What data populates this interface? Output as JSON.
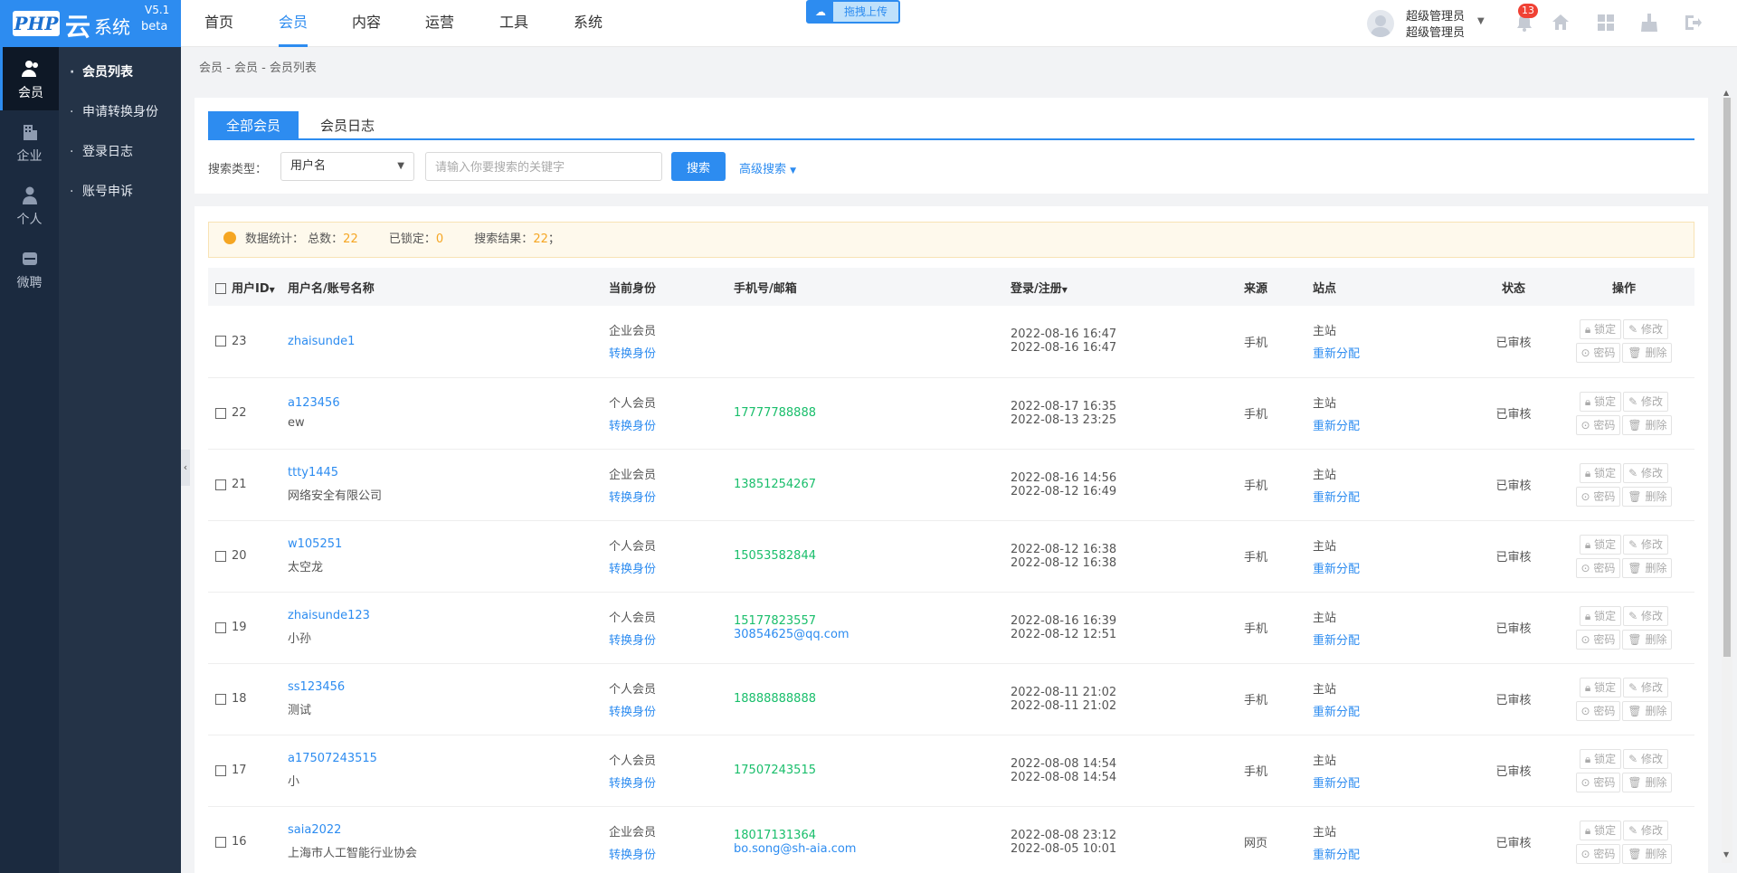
{
  "logo": {
    "brand": "PHP",
    "yun": "云",
    "system": "系统",
    "version": "V5.1",
    "beta": "beta"
  },
  "left_nav": [
    {
      "label": "会员",
      "icon": "members-icon",
      "active": true
    },
    {
      "label": "企业",
      "icon": "building-icon"
    },
    {
      "label": "个人",
      "icon": "person-icon"
    },
    {
      "label": "微聘",
      "icon": "micro-recruit-icon"
    }
  ],
  "sub_nav": [
    {
      "label": "会员列表",
      "active": true
    },
    {
      "label": "申请转换身份"
    },
    {
      "label": "登录日志"
    },
    {
      "label": "账号申诉"
    }
  ],
  "top_menu": [
    {
      "label": "首页"
    },
    {
      "label": "会员",
      "active": true
    },
    {
      "label": "内容"
    },
    {
      "label": "运营"
    },
    {
      "label": "工具"
    },
    {
      "label": "系统"
    }
  ],
  "upload": {
    "label": "拖拽上传"
  },
  "user": {
    "line1": "超级管理员",
    "line2": "超级管理员",
    "notifications": "13"
  },
  "breadcrumb": "会员 - 会员 - 会员列表",
  "tabs": [
    {
      "label": "全部会员",
      "active": true
    },
    {
      "label": "会员日志"
    }
  ],
  "search": {
    "type_label": "搜索类型：",
    "type_value": "用户名",
    "placeholder": "请输入你要搜索的关键字",
    "button": "搜索",
    "advanced": "高级搜索"
  },
  "stats": {
    "label": "数据统计：",
    "total_label": "总数：",
    "total": "22",
    "locked_label": "已锁定：",
    "locked": "0",
    "result_label": "搜索结果：",
    "result": "22",
    "end": "；"
  },
  "columns": {
    "id": "用户ID",
    "name": "用户名/账号名称",
    "identity": "当前身份",
    "contact": "手机号/邮箱",
    "time": "登录/注册",
    "source": "来源",
    "site": "站点",
    "status": "状态",
    "ops": "操作"
  },
  "row_actions": {
    "switch": "转换身份",
    "reassign": "重新分配",
    "lock": "锁定",
    "edit": "修改",
    "password": "密码",
    "delete": "删除"
  },
  "rows": [
    {
      "id": "23",
      "user": "zhaisunde1",
      "account": "",
      "identity": "企业会员",
      "phone": "",
      "email": "",
      "login": "2022-08-16 16:47",
      "reg": "2022-08-16 16:47",
      "source": "手机",
      "site": "主站",
      "status": "已审核"
    },
    {
      "id": "22",
      "user": "a123456",
      "account": "ew",
      "identity": "个人会员",
      "phone": "17777788888",
      "email": "",
      "login": "2022-08-17 16:35",
      "reg": "2022-08-13 23:25",
      "source": "手机",
      "site": "主站",
      "status": "已审核"
    },
    {
      "id": "21",
      "user": "ttty1445",
      "account": "网络安全有限公司",
      "identity": "企业会员",
      "phone": "13851254267",
      "email": "",
      "login": "2022-08-16 14:56",
      "reg": "2022-08-12 16:49",
      "source": "手机",
      "site": "主站",
      "status": "已审核"
    },
    {
      "id": "20",
      "user": "w105251",
      "account": "太空龙",
      "identity": "个人会员",
      "phone": "15053582844",
      "email": "",
      "login": "2022-08-12 16:38",
      "reg": "2022-08-12 16:38",
      "source": "手机",
      "site": "主站",
      "status": "已审核"
    },
    {
      "id": "19",
      "user": "zhaisunde123",
      "account": "小孙",
      "identity": "个人会员",
      "phone": "15177823557",
      "email": "30854625@qq.com",
      "login": "2022-08-16 16:39",
      "reg": "2022-08-12 12:51",
      "source": "手机",
      "site": "主站",
      "status": "已审核"
    },
    {
      "id": "18",
      "user": "ss123456",
      "account": "测试",
      "identity": "个人会员",
      "phone": "18888888888",
      "email": "",
      "login": "2022-08-11 21:02",
      "reg": "2022-08-11 21:02",
      "source": "手机",
      "site": "主站",
      "status": "已审核"
    },
    {
      "id": "17",
      "user": "a17507243515",
      "account": "小",
      "identity": "个人会员",
      "phone": "17507243515",
      "email": "",
      "login": "2022-08-08 14:54",
      "reg": "2022-08-08 14:54",
      "source": "手机",
      "site": "主站",
      "status": "已审核"
    },
    {
      "id": "16",
      "user": "saia2022",
      "account": "上海市人工智能行业协会",
      "identity": "企业会员",
      "phone": "18017131364",
      "email": "bo.song@sh-aia.com",
      "login": "2022-08-08 23:12",
      "reg": "2022-08-05 10:01",
      "source": "网页",
      "site": "主站",
      "status": "已审核"
    }
  ],
  "colors": {
    "accent": "#2d8cf0",
    "sidebar": "#1b2a3f",
    "phone": "#19be6b",
    "stat": "#f5a623"
  }
}
